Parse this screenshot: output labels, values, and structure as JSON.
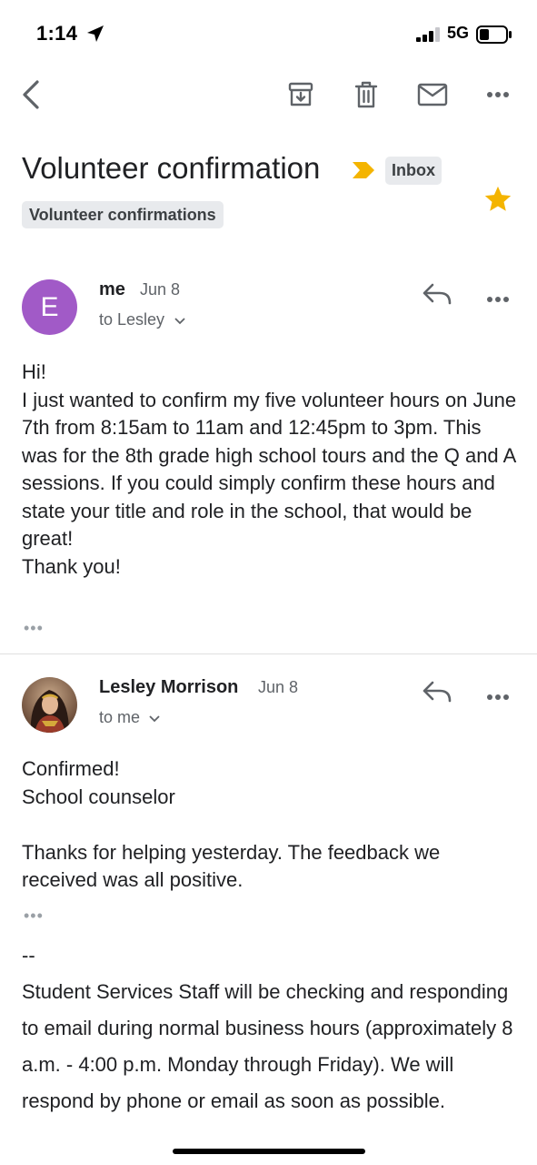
{
  "status_bar": {
    "time": "1:14",
    "network": "5G"
  },
  "toolbar": {
    "back_icon": "back-arrow-icon",
    "actions": [
      "archive-icon",
      "delete-icon",
      "mark-unread-icon",
      "more-icon"
    ]
  },
  "thread": {
    "subject": "Volunteer confirmation",
    "labels": {
      "inbox": "Inbox",
      "custom": "Volunteer confirmations"
    },
    "starred": true,
    "star_color": "#f4b400",
    "importance_color": "#f4b400"
  },
  "messages": [
    {
      "avatar_letter": "E",
      "avatar_color": "#a15ac7",
      "sender": "me",
      "date": "Jun 8",
      "to": "to Lesley",
      "body": "Hi!\nI just wanted to confirm my five volunteer hours on June 7th from 8:15am to 11am and 12:45pm to 3pm. This was for the 8th grade high school tours and the Q and A sessions. If you could simply confirm these hours and state your title and role in the school, that would be great!\nThank you!",
      "trimmed": "•••"
    },
    {
      "sender": "Lesley Morrison",
      "date": "Jun 8",
      "to": "to me",
      "body": "Confirmed!\nSchool counselor\n\nThanks for helping yesterday. The feedback we received was all positive.",
      "trimmed": "•••",
      "signature": "--\nStudent Services Staff will be checking and responding to email during normal business hours (approximately 8 a.m. - 4:00 p.m. Monday through Friday). We will respond by phone or email as soon as possible."
    }
  ]
}
